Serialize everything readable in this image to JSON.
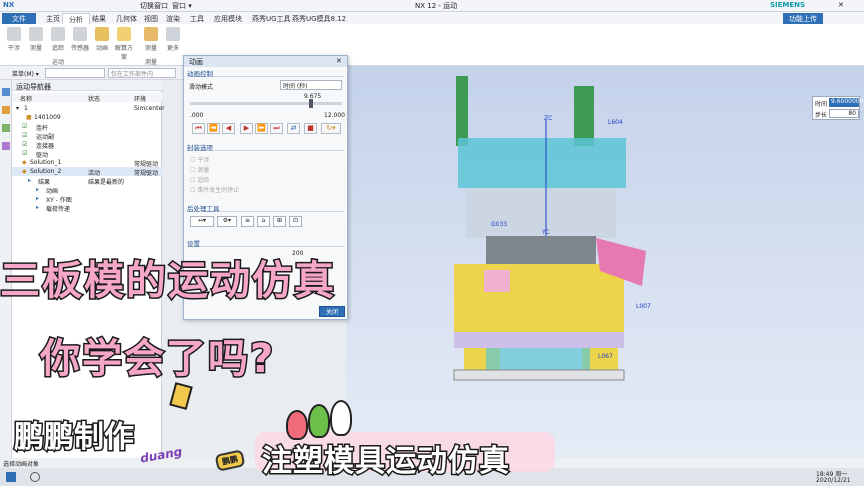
{
  "titlebar": {
    "logo": "NX",
    "title": "NX 12 - 运动",
    "brand": "SIEMENS",
    "window_menu": "窗口 ▾",
    "switch_window": "切换窗口"
  },
  "menu_tabs": [
    "文件(F)",
    "主页",
    "分析",
    "结果",
    "几何体",
    "视图",
    "渲染",
    "工具",
    "应用模块",
    "燕秀UG工具",
    "燕秀UG模具8.12"
  ],
  "active_tab": "分析",
  "share_button": "功能上传",
  "ribbon": {
    "buttons": [
      "干涉",
      "测量",
      "追踪",
      "传感器",
      "动画",
      "解算方案",
      "测量",
      "更多"
    ],
    "groups": [
      "运动",
      "测量"
    ]
  },
  "toolbar2": {
    "menu_label": "菜单(M) ▾",
    "filter_placeholder": "仅在工作部件内"
  },
  "navigator": {
    "title": "运动导航器",
    "columns": [
      "名称",
      "状态",
      "环境"
    ],
    "rows": [
      {
        "name": "1",
        "status": "",
        "env": "Simcenter"
      },
      {
        "name": "1401009",
        "status": "",
        "env": ""
      },
      {
        "name": "连杆",
        "status": "",
        "env": ""
      },
      {
        "name": "运动副",
        "status": "",
        "env": ""
      },
      {
        "name": "连接器",
        "status": "",
        "env": ""
      },
      {
        "name": "驱动",
        "status": "",
        "env": ""
      },
      {
        "name": "Solution_1",
        "status": "",
        "env": "常规驱动"
      },
      {
        "name": "Solution_2",
        "status": "活动",
        "env": "常规驱动"
      },
      {
        "name": "结果",
        "status": "结果是最新的",
        "env": ""
      },
      {
        "name": "动画",
        "status": "",
        "env": ""
      },
      {
        "name": "XY - 作图",
        "status": "",
        "env": ""
      },
      {
        "name": "载荷传递",
        "status": "",
        "env": ""
      }
    ]
  },
  "dialog": {
    "title": "动画",
    "section_playback": "动画控制",
    "slide_mode_label": "滑动模式",
    "slide_mode_value": "时间 (秒)",
    "current_value": "9.675",
    "min_value": ".000",
    "max_value": "12.000",
    "slider_fraction": 0.806,
    "section_envelope": "封装选项",
    "envelope_options": [
      "干涉",
      "测量",
      "追踪",
      "事件发生时停止"
    ],
    "section_post": "后处理工具",
    "section_settings": "设置",
    "settings_value": "200",
    "close_button": "关闭"
  },
  "time_panel": {
    "time_label": "时间",
    "time_value": "9.6000000",
    "step_label": "步长",
    "step_value": "80"
  },
  "model_labels": [
    "ZC",
    "L604",
    "G033",
    "L007",
    "L067",
    "YC"
  ],
  "captions": {
    "line1": "三板模的运动仿真",
    "line2": "你学会了吗?",
    "author": "鹏鹏制作",
    "bottom": "注塑模具运动仿真",
    "badge": "鹏鹏",
    "sticker": "duang"
  },
  "status_bar": "选择动画对象",
  "taskbar": {
    "time": "18:49 周一",
    "date": "2020/12/21"
  },
  "colors": {
    "accent": "#2e6fb5",
    "caption_pink": "#f6a7c8",
    "mold_yellow": "#ecd54a",
    "mold_cyan": "#5cc4d6"
  }
}
